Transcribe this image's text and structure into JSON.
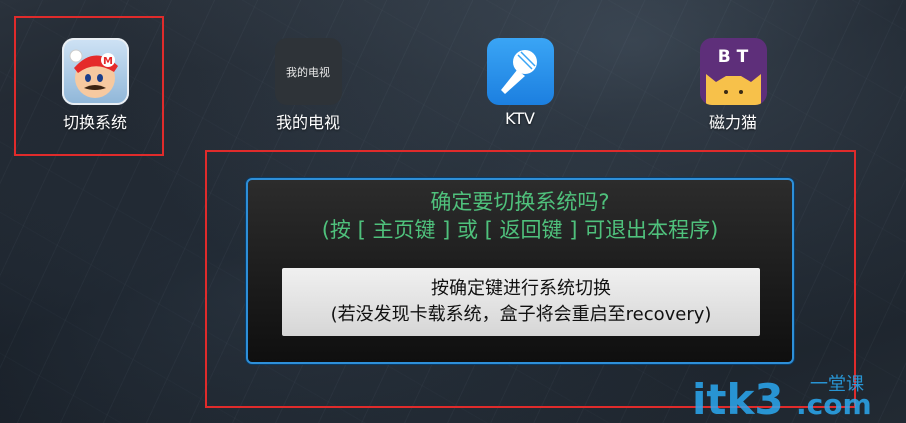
{
  "apps": [
    {
      "label": "切换系统",
      "icon": "mario-icon"
    },
    {
      "label": "我的电视",
      "icon": "tv-icon",
      "icon_text": "我的电视"
    },
    {
      "label": "KTV",
      "icon": "microphone-icon"
    },
    {
      "label": "磁力猫",
      "icon": "cat-icon",
      "icon_text": "B T"
    }
  ],
  "dialog": {
    "title": "确定要切换系统吗?",
    "subtitle": "(按 [ 主页键 ] 或 [ 返回键 ] 可退出本程序)",
    "confirm_line1": "按确定键进行系统切换",
    "confirm_line2": "(若没发现卡载系统，盒子将会重启至recovery)"
  },
  "watermark": {
    "main": "itk3",
    "suffix": ".com",
    "tag": "一堂课"
  },
  "colors": {
    "highlight_red": "#e02b2b",
    "dialog_border": "#2e8fd8",
    "dialog_text": "#4fc17c",
    "watermark_blue": "#2aa8f0"
  }
}
